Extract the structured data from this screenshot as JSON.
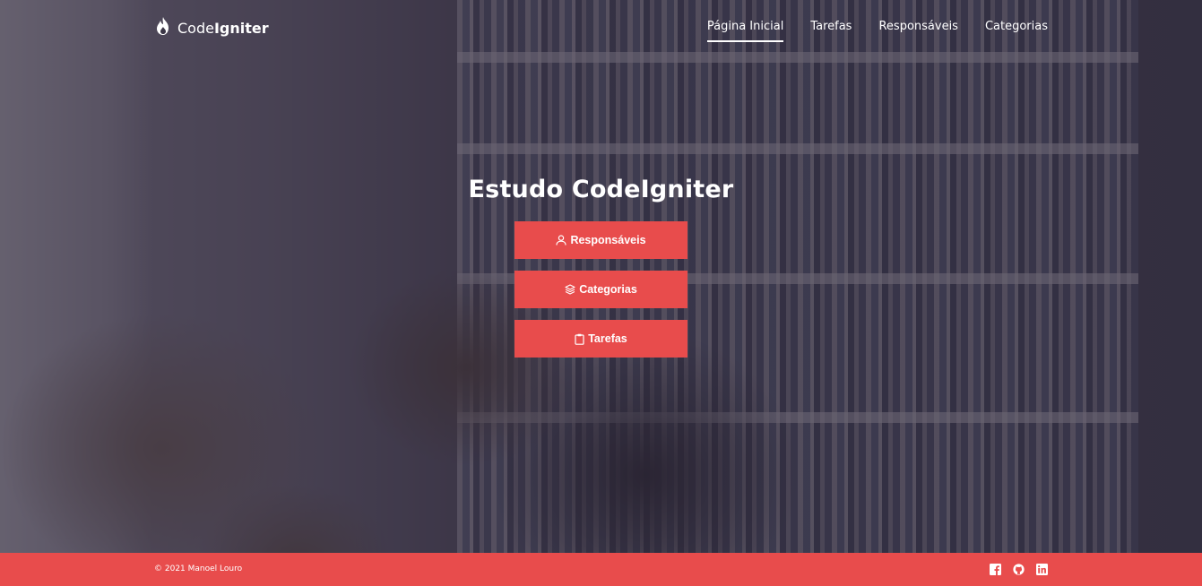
{
  "header": {
    "logo_light": "Code",
    "logo_bold": "Igniter",
    "nav": [
      {
        "label": "Página Inicial",
        "active": true
      },
      {
        "label": "Tarefas",
        "active": false
      },
      {
        "label": "Responsáveis",
        "active": false
      },
      {
        "label": "Categorias",
        "active": false
      }
    ]
  },
  "hero": {
    "title": "Estudo CodeIgniter",
    "buttons": {
      "responsaveis": {
        "label": "Responsáveis",
        "icon": "user-icon"
      },
      "categorias": {
        "label": "Categorias",
        "icon": "layers-icon"
      },
      "tarefas": {
        "label": "Tarefas",
        "icon": "clipboard-icon"
      }
    }
  },
  "footer": {
    "copyright": "© 2021 Manoel Louro",
    "social": [
      "facebook-icon",
      "github-icon",
      "linkedin-icon"
    ]
  },
  "colors": {
    "accent": "#e84c4c",
    "overlay": "#282234",
    "text": "#ffffff"
  }
}
